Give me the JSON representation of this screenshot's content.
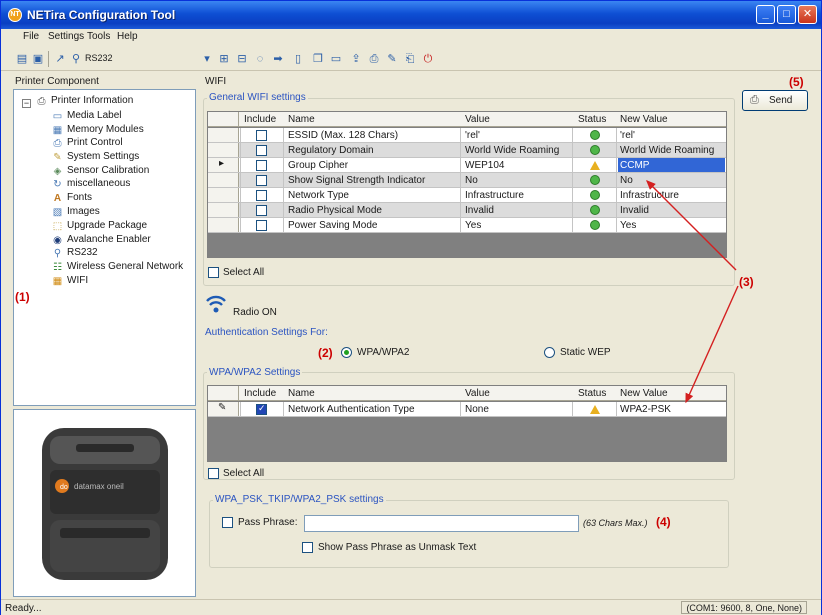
{
  "window": {
    "title": "NETira Configuration Tool",
    "app_icon_text": "NT"
  },
  "menu": [
    "File",
    "Settings",
    "Tools",
    "Help"
  ],
  "toolbar": {
    "port_label": "RS232"
  },
  "left_panel": {
    "title": "Printer Component",
    "tree": [
      {
        "label": "Printer Information",
        "icon": "printer-icon",
        "level": 0
      },
      {
        "label": "Media Label",
        "icon": "label-icon",
        "level": 1
      },
      {
        "label": "Memory Modules",
        "icon": "memory-icon",
        "level": 1
      },
      {
        "label": "Print Control",
        "icon": "print-control-icon",
        "level": 1
      },
      {
        "label": "System Settings",
        "icon": "wrench-icon",
        "level": 1
      },
      {
        "label": "Sensor Calibration",
        "icon": "sensor-icon",
        "level": 1
      },
      {
        "label": "miscellaneous",
        "icon": "misc-icon",
        "level": 1
      },
      {
        "label": "Fonts",
        "icon": "font-icon",
        "level": 1
      },
      {
        "label": "Images",
        "icon": "image-icon",
        "level": 1
      },
      {
        "label": "Upgrade Package",
        "icon": "package-icon",
        "level": 1
      },
      {
        "label": "Avalanche Enabler",
        "icon": "avalanche-icon",
        "level": 1
      },
      {
        "label": "RS232",
        "icon": "serial-icon",
        "level": 1
      },
      {
        "label": "Wireless General Network",
        "icon": "network-icon",
        "level": 1
      },
      {
        "label": "WIFI",
        "icon": "wifi-icon",
        "level": 1
      }
    ],
    "device_brand": "datamax oneil"
  },
  "main": {
    "title": "WIFI",
    "general_group_label": "General WIFI settings",
    "columns": [
      "Include",
      "Name",
      "Value",
      "Status",
      "New Value"
    ],
    "general_rows": [
      {
        "name": "ESSID (Max. 128 Chars)",
        "value": "'rel'",
        "status": "ok",
        "new_value": "'rel'",
        "shaded": false
      },
      {
        "name": "Regulatory Domain",
        "value": "World Wide Roaming",
        "status": "ok",
        "new_value": "World Wide Roaming",
        "shaded": true
      },
      {
        "name": "Group Cipher",
        "value": "WEP104",
        "status": "warn",
        "new_value": "CCMP",
        "shaded": false,
        "current": true
      },
      {
        "name": "Show Signal Strength Indicator",
        "value": "No",
        "status": "ok",
        "new_value": "No",
        "shaded": true
      },
      {
        "name": "Network Type",
        "value": "Infrastructure",
        "status": "ok",
        "new_value": "Infrastructure",
        "shaded": false
      },
      {
        "name": "Radio Physical Mode",
        "value": "Invalid",
        "status": "ok",
        "new_value": "Invalid",
        "shaded": true
      },
      {
        "name": "Power Saving Mode",
        "value": "Yes",
        "status": "ok",
        "new_value": "Yes",
        "shaded": false
      }
    ],
    "select_all": "Select All",
    "radio_status": "Radio ON",
    "auth_label": "Authentication Settings For:",
    "auth_options": [
      "WPA/WPA2",
      "Static WEP"
    ],
    "auth_selected": "WPA/WPA2",
    "wpa_group_label": "WPA/WPA2 Settings",
    "wpa_rows": [
      {
        "name": "Network Authentication Type",
        "value": "None",
        "status": "warn",
        "new_value": "WPA2-PSK",
        "included": true
      }
    ],
    "psk_group_label": "WPA_PSK_TKIP/WPA2_PSK settings",
    "pass_phrase_label": "Pass Phrase:",
    "pass_phrase_value": "",
    "pass_phrase_hint": "(63 Chars Max.)",
    "show_pass_label": "Show Pass Phrase as Unmask Text",
    "send_label": "Send"
  },
  "annotations": {
    "a1": "(1)",
    "a2": "(2)",
    "a3": "(3)",
    "a4": "(4)",
    "a5": "(5)"
  },
  "statusbar": {
    "left": "Ready...",
    "right": "(COM1: 9600, 8, One, None)"
  },
  "colors": {
    "accent": "#cc0000",
    "selected_cell": "#3166d6",
    "title_blue": "#0a3fc2"
  }
}
